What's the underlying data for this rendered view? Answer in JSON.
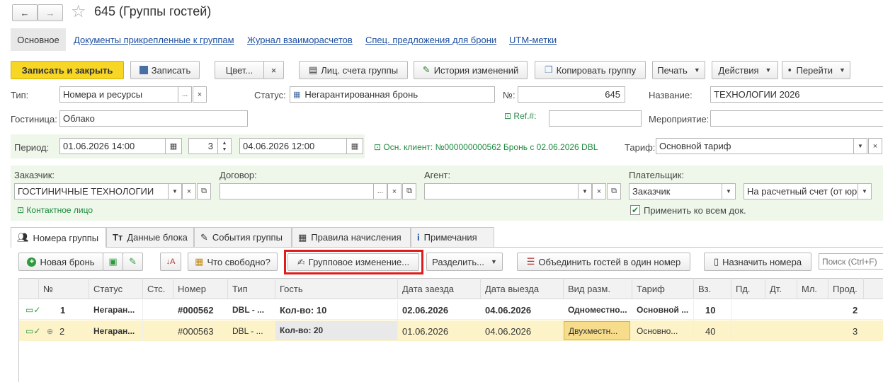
{
  "window": {
    "title": "645 (Группы гостей)",
    "back": "←",
    "forward": "→",
    "star": "☆"
  },
  "nav": {
    "tabs": [
      "Основное",
      "Документы прикрепленные к группам",
      "Журнал взаиморасчетов",
      "Спец. предложения для брони",
      "UTM-метки"
    ]
  },
  "toolbar": {
    "save_close": "Записать и закрыть",
    "save": "Записать",
    "color": "Цвет...",
    "color_clear": "×",
    "accounts": "Лиц. счета группы",
    "history": "История изменений",
    "copy": "Копировать группу",
    "print": "Печать",
    "actions": "Действия",
    "goto": "Перейти"
  },
  "form": {
    "type_label": "Тип:",
    "type_value": "Номера и ресурсы",
    "status_label": "Статус:",
    "status_value": "Негарантированная бронь",
    "num_label": "№:",
    "num_value": "645",
    "name_label": "Название:",
    "name_value": "ТЕХНОЛОГИИ 2026",
    "hotel_label": "Гостиница:",
    "hotel_value": "Облако",
    "ref_label": "Ref.#:",
    "event_label": "Мероприятие:",
    "period_label": "Период:",
    "date_from": "01.06.2026 14:00",
    "nights": "3",
    "date_to": "04.06.2026 12:00",
    "main_client": "Осн. клиент: №000000000562 Бронь с 02.06.2026 DBL",
    "tariff_label": "Тариф:",
    "tariff_value": "Основной тариф",
    "customer_label": "Заказчик:",
    "customer_value": "ГОСТИНИЧНЫЕ ТЕХНОЛОГИИ",
    "contract_label": "Договор:",
    "agent_label": "Агент:",
    "payer_label": "Плательщик:",
    "payer_value": "Заказчик",
    "payer_account": "На расчетный счет (от юр",
    "contact": "Контактное лицо",
    "apply_all": "Применить ко всем док."
  },
  "tabs": [
    "Номера группы",
    "Данные блока",
    "События группы",
    "Правила начисления",
    "Примечания"
  ],
  "table_toolbar": {
    "new_booking": "Новая бронь",
    "free": "Что свободно?",
    "group_change": "Групповое изменение...",
    "split": "Разделить...",
    "merge": "Объединить гостей в один номер",
    "assign": "Назначить номера",
    "search_placeholder": "Поиск (Ctrl+F)"
  },
  "table": {
    "headers": [
      "№",
      "Статус",
      "Стс.",
      "Номер",
      "Тип",
      "Гость",
      "Дата заезда",
      "Дата выезда",
      "Вид разм.",
      "Тариф",
      "Вз.",
      "Пд.",
      "Дт.",
      "Мл.",
      "Прод."
    ],
    "rows": [
      [
        "1",
        "Негаран...",
        "",
        "#000562",
        "DBL - ...",
        "Кол-во: 10",
        "02.06.2026",
        "04.06.2026",
        "Одноместно...",
        "Основной ...",
        "10",
        "",
        "",
        "",
        "2"
      ],
      [
        "2",
        "Негаран...",
        "",
        "#000563",
        "DBL - ...",
        "Кол-во: 20",
        "01.06.2026",
        "04.06.2026",
        "Двухместн...",
        "Основно...",
        "40",
        "",
        "",
        "",
        "3"
      ]
    ]
  },
  "colors": {
    "accent_yellow": "#f7d626",
    "link": "#1d4fa0",
    "green": "#1e8a3e",
    "highlight_red": "#e01b1b",
    "row_selected": "#fdf3c8"
  }
}
